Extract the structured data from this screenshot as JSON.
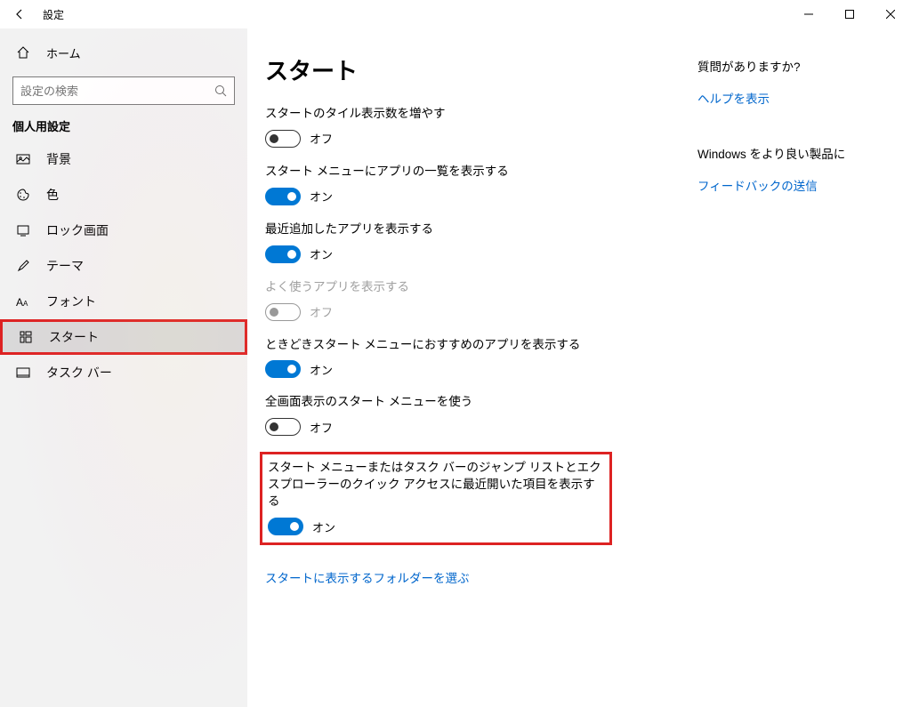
{
  "window": {
    "title": "設定"
  },
  "sidebar": {
    "home": "ホーム",
    "search_placeholder": "設定の検索",
    "section": "個人用設定",
    "items": [
      {
        "label": "背景"
      },
      {
        "label": "色"
      },
      {
        "label": "ロック画面"
      },
      {
        "label": "テーマ"
      },
      {
        "label": "フォント"
      },
      {
        "label": "スタート"
      },
      {
        "label": "タスク バー"
      }
    ]
  },
  "page": {
    "title": "スタート",
    "settings": [
      {
        "label": "スタートのタイル表示数を増やす",
        "on": false,
        "state": "オフ"
      },
      {
        "label": "スタート メニューにアプリの一覧を表示する",
        "on": true,
        "state": "オン"
      },
      {
        "label": "最近追加したアプリを表示する",
        "on": true,
        "state": "オン"
      },
      {
        "label": "よく使うアプリを表示する",
        "on": false,
        "state": "オフ",
        "disabled": true
      },
      {
        "label": "ときどきスタート メニューにおすすめのアプリを表示する",
        "on": true,
        "state": "オン"
      },
      {
        "label": "全画面表示のスタート メニューを使う",
        "on": false,
        "state": "オフ"
      },
      {
        "label": "スタート メニューまたはタスク バーのジャンプ リストとエクスプローラーのクイック アクセスに最近開いた項目を表示する",
        "on": true,
        "state": "オン",
        "boxed": true
      }
    ],
    "folder_link": "スタートに表示するフォルダーを選ぶ"
  },
  "help": {
    "q_title": "質問がありますか?",
    "q_link": "ヘルプを表示",
    "fb_title": "Windows をより良い製品に",
    "fb_link": "フィードバックの送信"
  }
}
